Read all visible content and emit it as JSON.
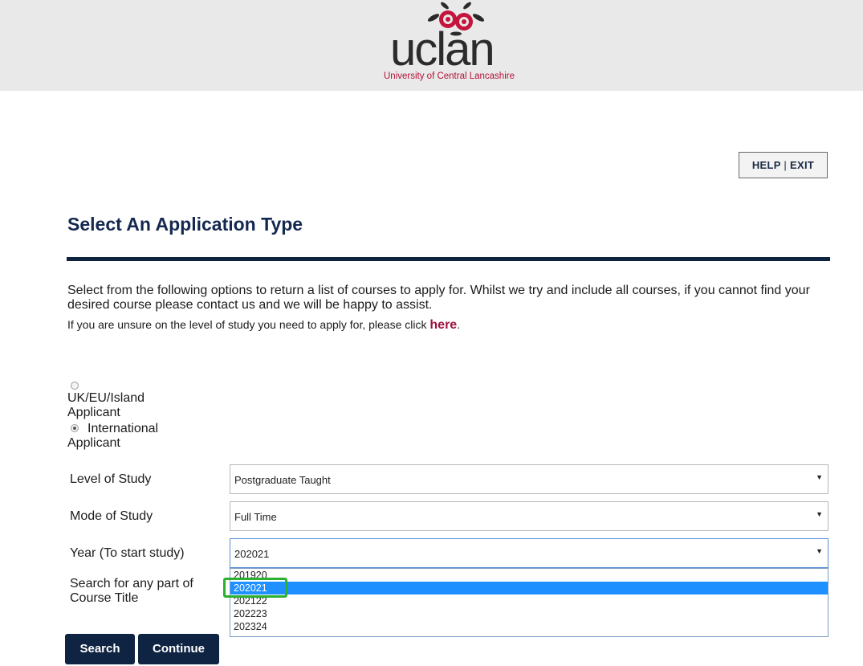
{
  "header": {
    "logo_word": "uclan",
    "logo_subtitle": "University of Central Lancashire"
  },
  "top_links": {
    "help": "HELP",
    "separator": "|",
    "exit": "EXIT"
  },
  "page_title": "Select An Application Type",
  "intro_text": "Select from the following options to return a list of courses to apply for. Whilst we try and include all courses, if you cannot find your desired course please contact us and we will be happy to assist.",
  "unsure_text": "If you are unsure on the level of study you need to apply for, please click",
  "unsure_link": "here",
  "unsure_period": ".",
  "applicant_type": {
    "options": [
      {
        "label_line1": "UK/EU/Island",
        "label_line2": "Applicant",
        "checked": false
      },
      {
        "label_line1": "International",
        "label_line2": "Applicant",
        "checked": true
      }
    ]
  },
  "form": {
    "level_label": "Level of Study",
    "level_value": "Postgraduate Taught",
    "mode_label": "Mode of Study",
    "mode_value": "Full Time",
    "year_label": "Year (To start study)",
    "year_value": "202021",
    "year_options": [
      "201920",
      "202021",
      "202122",
      "202223",
      "202324"
    ],
    "year_selected_index": 1,
    "search_label_line1": "Search for any part of",
    "search_label_line2": "Course Title"
  },
  "buttons": {
    "search": "Search",
    "continue": "Continue"
  },
  "colors": {
    "navy": "#0f2442",
    "crimson": "#a1113b",
    "highlight": "#1e90ff",
    "annotation_green": "#2bb02f"
  },
  "icons": {
    "dropdown_arrow": "▼"
  }
}
